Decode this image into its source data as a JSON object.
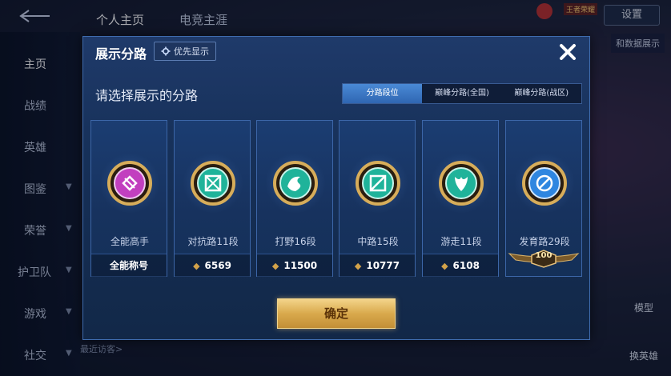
{
  "background": {
    "top_tabs": [
      "个人主页",
      "电竞主涯"
    ],
    "settings_label": "设置",
    "top_badge": "王者荣耀",
    "side_nav": [
      {
        "label": "主页",
        "active": true,
        "chevron": false
      },
      {
        "label": "战绩",
        "active": false,
        "chevron": false
      },
      {
        "label": "英雄",
        "active": false,
        "chevron": false
      },
      {
        "label": "图鉴",
        "active": false,
        "chevron": true
      },
      {
        "label": "荣誉",
        "active": false,
        "chevron": true
      },
      {
        "label": "护卫队",
        "active": false,
        "chevron": true
      },
      {
        "label": "游戏",
        "active": false,
        "chevron": true
      },
      {
        "label": "社交",
        "active": false,
        "chevron": true
      }
    ],
    "right_text": "和数据展示",
    "right_buttons": [
      "模型",
      "换英雄"
    ],
    "recent_visitors": "最近访客>"
  },
  "modal": {
    "title": "展示分路",
    "priority_label": "优先显示",
    "prompt": "请选择展示的分路",
    "tabs": [
      {
        "label": "分路段位",
        "active": true
      },
      {
        "label": "巅峰分路(全国)",
        "active": false
      },
      {
        "label": "巅峰分路(战区)",
        "active": false
      }
    ],
    "cards": [
      {
        "name": "全能高手",
        "footer": "全能称号",
        "has_points": false,
        "emblem_color": "#c23fbf",
        "emblem": "all-round-emblem-icon"
      },
      {
        "name": "对抗路11段",
        "footer": "6569",
        "has_points": true,
        "emblem_color": "#1fb39a",
        "emblem": "clash-lane-emblem-icon"
      },
      {
        "name": "打野16段",
        "footer": "11500",
        "has_points": true,
        "emblem_color": "#1fb39a",
        "emblem": "jungle-emblem-icon"
      },
      {
        "name": "中路15段",
        "footer": "10777",
        "has_points": true,
        "emblem_color": "#1fb39a",
        "emblem": "mid-lane-emblem-icon"
      },
      {
        "name": "游走11段",
        "footer": "6108",
        "has_points": true,
        "emblem_color": "#1fb39a",
        "emblem": "roam-emblem-icon"
      },
      {
        "name": "发育路29段",
        "footer": "100",
        "has_points": false,
        "crown": true,
        "emblem_color": "#2f86e0",
        "emblem": "farm-lane-emblem-icon"
      }
    ],
    "confirm_label": "确定"
  },
  "colors": {
    "accent_gold": "#d9a94c",
    "modal_bg": "#163058",
    "tab_active": "#3f7ac6"
  }
}
